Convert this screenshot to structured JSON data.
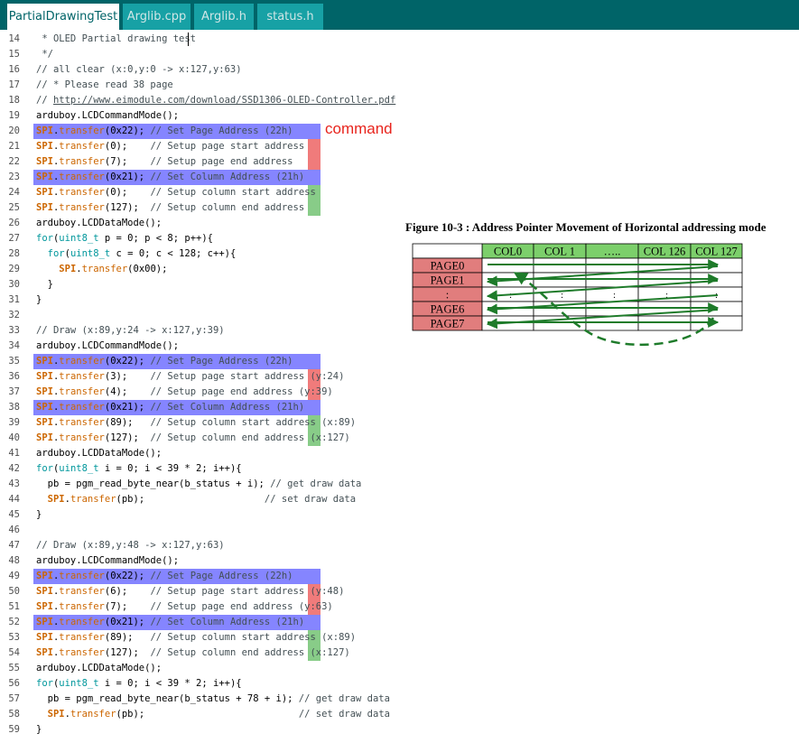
{
  "tabs": [
    {
      "label": "PartialDrawingTest",
      "active": true
    },
    {
      "label": "Arglib.cpp",
      "active": false
    },
    {
      "label": "Arglib.h",
      "active": false
    },
    {
      "label": "status.h",
      "active": false
    }
  ],
  "editor": {
    "lines": [
      {
        "n": "14",
        "text": " * OLED Partial drawing test",
        "kind": "comment"
      },
      {
        "n": "15",
        "text": " */",
        "kind": "comment"
      },
      {
        "n": "16",
        "text": "// all clear (x:0,y:0 -> x:127,y:63)",
        "kind": "comment"
      },
      {
        "n": "17",
        "text": "// * Please read 38 page",
        "kind": "comment"
      },
      {
        "n": "18",
        "text": "// http://www.eimodule.com/download/SSD1306-OLED-Controller.pdf",
        "kind": "link"
      },
      {
        "n": "19",
        "text": "arduboy.LCDCommandMode();",
        "kind": "code"
      },
      {
        "n": "20",
        "text": "SPI.transfer(0x22); // Set Page Address (22h)",
        "kind": "cmd"
      },
      {
        "n": "21",
        "text": "SPI.transfer(0);    // Setup page start address",
        "kind": "red"
      },
      {
        "n": "22",
        "text": "SPI.transfer(7);    // Setup page end address",
        "kind": "red"
      },
      {
        "n": "23",
        "text": "SPI.transfer(0x21); // Set Column Address (21h)",
        "kind": "cmd"
      },
      {
        "n": "24",
        "text": "SPI.transfer(0);    // Setup column start address",
        "kind": "green"
      },
      {
        "n": "25",
        "text": "SPI.transfer(127);  // Setup column end address",
        "kind": "green"
      },
      {
        "n": "26",
        "text": "arduboy.LCDDataMode();",
        "kind": "code"
      },
      {
        "n": "27",
        "text": "for(uint8_t p = 0; p < 8; p++){",
        "kind": "code"
      },
      {
        "n": "28",
        "text": "  for(uint8_t c = 0; c < 128; c++){",
        "kind": "code"
      },
      {
        "n": "29",
        "text": "    SPI.transfer(0x00);",
        "kind": "code"
      },
      {
        "n": "30",
        "text": "  }",
        "kind": "code"
      },
      {
        "n": "31",
        "text": "}",
        "kind": "code"
      },
      {
        "n": "32",
        "text": "",
        "kind": "code"
      },
      {
        "n": "33",
        "text": "// Draw (x:89,y:24 -> x:127,y:39)",
        "kind": "comment"
      },
      {
        "n": "34",
        "text": "arduboy.LCDCommandMode();",
        "kind": "code"
      },
      {
        "n": "35",
        "text": "SPI.transfer(0x22); // Set Page Address (22h)",
        "kind": "cmd"
      },
      {
        "n": "36",
        "text": "SPI.transfer(3);    // Setup page start address (y:24)",
        "kind": "red"
      },
      {
        "n": "37",
        "text": "SPI.transfer(4);    // Setup page end address (y:39)",
        "kind": "red"
      },
      {
        "n": "38",
        "text": "SPI.transfer(0x21); // Set Column Address (21h)",
        "kind": "cmd"
      },
      {
        "n": "39",
        "text": "SPI.transfer(89);   // Setup column start address (x:89)",
        "kind": "green"
      },
      {
        "n": "40",
        "text": "SPI.transfer(127);  // Setup column end address (x:127)",
        "kind": "green"
      },
      {
        "n": "41",
        "text": "arduboy.LCDDataMode();",
        "kind": "code"
      },
      {
        "n": "42",
        "text": "for(uint8_t i = 0; i < 39 * 2; i++){",
        "kind": "code"
      },
      {
        "n": "43",
        "text": "  pb = pgm_read_byte_near(b_status + i); // get draw data",
        "kind": "code"
      },
      {
        "n": "44",
        "text": "  SPI.transfer(pb);                     // set draw data",
        "kind": "code"
      },
      {
        "n": "45",
        "text": "}",
        "kind": "code"
      },
      {
        "n": "46",
        "text": "",
        "kind": "code"
      },
      {
        "n": "47",
        "text": "// Draw (x:89,y:48 -> x:127,y:63)",
        "kind": "comment"
      },
      {
        "n": "48",
        "text": "arduboy.LCDCommandMode();",
        "kind": "code"
      },
      {
        "n": "49",
        "text": "SPI.transfer(0x22); // Set Page Address (22h)",
        "kind": "cmd"
      },
      {
        "n": "50",
        "text": "SPI.transfer(6);    // Setup page start address (y:48)",
        "kind": "red"
      },
      {
        "n": "51",
        "text": "SPI.transfer(7);    // Setup page end address (y:63)",
        "kind": "red"
      },
      {
        "n": "52",
        "text": "SPI.transfer(0x21); // Set Column Address (21h)",
        "kind": "cmd"
      },
      {
        "n": "53",
        "text": "SPI.transfer(89);   // Setup column start address (x:89)",
        "kind": "green"
      },
      {
        "n": "54",
        "text": "SPI.transfer(127);  // Setup column end address (x:127)",
        "kind": "green"
      },
      {
        "n": "55",
        "text": "arduboy.LCDDataMode();",
        "kind": "code"
      },
      {
        "n": "56",
        "text": "for(uint8_t i = 0; i < 39 * 2; i++){",
        "kind": "code"
      },
      {
        "n": "57",
        "text": "  pb = pgm_read_byte_near(b_status + 78 + i); // get draw data",
        "kind": "code"
      },
      {
        "n": "58",
        "text": "  SPI.transfer(pb);                           // set draw data",
        "kind": "code"
      },
      {
        "n": "59",
        "text": "}",
        "kind": "code"
      }
    ],
    "annotation_label": "command"
  },
  "figure": {
    "title": "Figure 10-3 : Address Pointer Movement of Horizontal addressing mode",
    "col_headers": [
      "COL0",
      "COL 1",
      "…..",
      "COL 126",
      "COL 127"
    ],
    "row_headers": [
      "PAGE0",
      "PAGE1",
      ":",
      "PAGE6",
      "PAGE7"
    ],
    "dots": ":"
  },
  "colors": {
    "tab_bar": "#006468",
    "tab_inactive": "#17a1a5",
    "command_highlight": "#8585ff",
    "page_bar": "#f07b7b",
    "column_bar": "#88cc88",
    "annotation": "#e8241d",
    "keyword": "#cc6600",
    "type": "#00979c",
    "comment": "#434f54",
    "figure_header": "#7ccf6b",
    "figure_page": "#e17d7d",
    "arrow": "#1e7b2a"
  }
}
